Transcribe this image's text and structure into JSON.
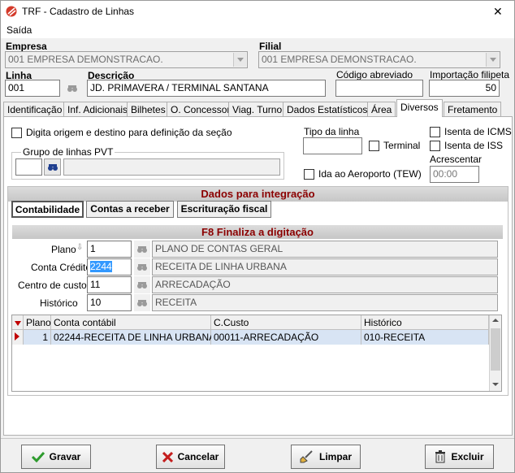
{
  "window": {
    "title": "TRF - Cadastro de Linhas",
    "close_glyph": "✕"
  },
  "menu": {
    "items": [
      "Saída"
    ]
  },
  "header": {
    "empresa": {
      "label": "Empresa",
      "value": "001 EMPRESA DEMONSTRACAO."
    },
    "filial": {
      "label": "Filial",
      "value": "001 EMPRESA DEMONSTRACAO."
    },
    "linha": {
      "label": "Linha",
      "value": "001"
    },
    "descricao": {
      "label": "Descrição",
      "value": "JD. PRIMAVERA / TERMINAL SANTANA"
    },
    "codigo_abreviado": {
      "label": "Código abreviado",
      "value": ""
    },
    "importacao_filipeta": {
      "label": "Importação filipeta",
      "value": "50"
    }
  },
  "tabs": [
    "Identificação",
    "Inf. Adicionais",
    "Bilhetes",
    "O. Concessor",
    "Viag. Turno",
    "Dados Estatísticos",
    "Área",
    "Diversos",
    "Fretamento"
  ],
  "diversos": {
    "digita_origem": "Digita origem e destino para definição da seção",
    "grupo_pvt": {
      "label": "Grupo de linhas PVT",
      "code": "",
      "desc": ""
    },
    "tipo_linha": {
      "label": "Tipo da linha",
      "value": ""
    },
    "terminal": "Terminal",
    "ida_aeroporto": "Ida ao Aeroporto (TEW)",
    "isenta_icms": "Isenta de ICMS",
    "isenta_iss": "Isenta de ISS",
    "acrescentar": {
      "label": "Acrescentar",
      "value": "00:00"
    }
  },
  "integracao": {
    "title": "Dados para integração",
    "subtabs": [
      "Contabilidade",
      "Contas a receber",
      "Escrituração fiscal"
    ],
    "subtitle": "F8 Finaliza a digitação",
    "plano": {
      "label": "Plano",
      "code": "1",
      "desc": "PLANO DE CONTAS GERAL"
    },
    "conta_credito": {
      "label": "Conta Crédito",
      "code": "2244",
      "desc": "RECEITA DE LINHA URBANA"
    },
    "centro_custos": {
      "label": "Centro de custos",
      "code": "11",
      "desc": "ARRECADAÇÃO"
    },
    "historico": {
      "label": "Histórico",
      "code": "10",
      "desc": "RECEITA"
    },
    "grid": {
      "columns": [
        "Plano",
        "Conta contábil",
        "C.Custo",
        "Histórico"
      ],
      "rows": [
        [
          "1",
          "02244-RECEITA DE LINHA URBANA",
          "00011-ARRECADAÇÃO",
          "010-RECEITA"
        ]
      ]
    }
  },
  "footer": {
    "gravar": "Gravar",
    "cancelar": "Cancelar",
    "limpar": "Limpar",
    "excluir": "Excluir"
  },
  "colors": {
    "accent_red": "#8b0000",
    "selection_blue": "#3399ff"
  }
}
